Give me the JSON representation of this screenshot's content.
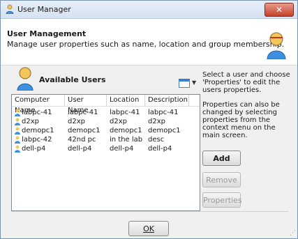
{
  "window": {
    "title": "User Manager",
    "close_label": "✕"
  },
  "header": {
    "title": "User Management",
    "description": "Manage user properties such as name, location and group membership."
  },
  "users_panel": {
    "label": "Available Users",
    "columns": [
      "Computer Name",
      "User Name",
      "Location",
      "Description"
    ],
    "rows": [
      {
        "computer": "labpc-41",
        "user": "labpc-41",
        "location": "labpc-41",
        "description": "labpc-41"
      },
      {
        "computer": "d2xp",
        "user": "d2xp",
        "location": "d2xp",
        "description": "d2xp"
      },
      {
        "computer": "demopc1",
        "user": "demopc1",
        "location": "demopc1",
        "description": "demopc1"
      },
      {
        "computer": "labpc-42",
        "user": "42nd pc",
        "location": "in the lab",
        "description": "desc"
      },
      {
        "computer": "dell-p4",
        "user": "dell-p4",
        "location": "dell-p4",
        "description": "dell-p4"
      }
    ]
  },
  "side": {
    "help1": "Select a user and choose 'Properties' to edit the users properties.",
    "help2": "Properties can also be changed by selecting properties from the context menu on the main screen.",
    "add_label": "Add",
    "remove_label": "Remove",
    "properties_label": "Properties"
  },
  "footer": {
    "ok_label": "OK"
  },
  "colors": {
    "accent": "#3d7fd0",
    "close": "#c6402a"
  }
}
